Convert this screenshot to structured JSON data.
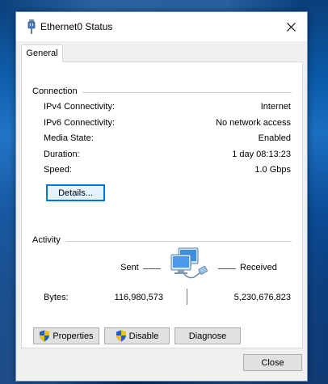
{
  "window": {
    "title": "Ethernet0 Status",
    "tab_general": "General"
  },
  "connection": {
    "heading": "Connection",
    "rows": [
      {
        "label": "IPv4 Connectivity:",
        "value": "Internet"
      },
      {
        "label": "IPv6 Connectivity:",
        "value": "No network access"
      },
      {
        "label": "Media State:",
        "value": "Enabled"
      },
      {
        "label": "Duration:",
        "value": "1 day 08:13:23"
      },
      {
        "label": "Speed:",
        "value": "1.0 Gbps"
      }
    ],
    "details_button": "Details..."
  },
  "activity": {
    "heading": "Activity",
    "sent_label": "Sent",
    "received_label": "Received",
    "bytes_label": "Bytes:",
    "bytes_sent": "116,980,573",
    "bytes_received": "5,230,676,823"
  },
  "buttons": {
    "properties": "Properties",
    "disable": "Disable",
    "diagnose": "Diagnose",
    "close": "Close"
  },
  "icons": {
    "title": "ethernet-cable-icon",
    "close": "close-icon",
    "activity": "network-computers-icon",
    "shield": "uac-shield-icon"
  },
  "colors": {
    "focus_accent": "#0078d7",
    "shield_blue": "#1f5fbf",
    "shield_yellow": "#f2c200"
  }
}
